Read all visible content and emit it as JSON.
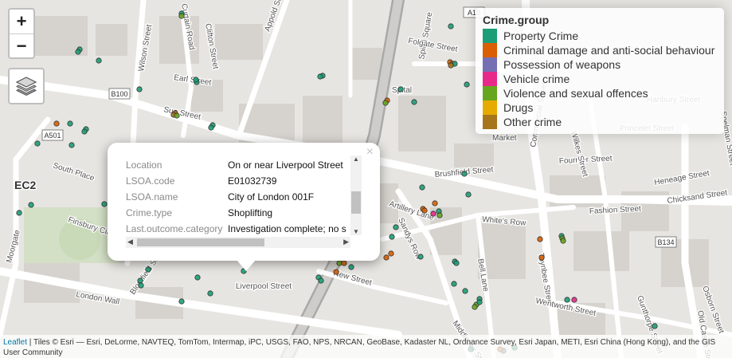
{
  "map": {
    "area_labels": [
      "EC2"
    ],
    "street_labels": [
      "Curtain Road",
      "Clifton Street",
      "Appold Street",
      "Wilson Street",
      "Earl Street",
      "Sun Street",
      "South Place",
      "Finsbury Circus",
      "Moorgate",
      "London Wall",
      "Blomfield Street",
      "Liverpool Street",
      "New Street",
      "Artillery Lane",
      "Sandys Row",
      "Bell Lane",
      "Toynbee Street",
      "Commercial Street",
      "Wentworth Street",
      "Gunthorpe Street",
      "Osborn Street",
      "Fashion Street",
      "Chicksand Street",
      "Heneage Street",
      "Fournier Street",
      "Brushfield Street",
      "White's Row",
      "Spital Square",
      "Folgate Street",
      "Spital",
      "Market",
      "Wilkes Street",
      "Princelet Street",
      "Hanbury Street",
      "Spelman Street",
      "Middlesex Street",
      "Old Castle Street"
    ],
    "road_badges": [
      "B100",
      "A501",
      "A10",
      "B134"
    ]
  },
  "controls": {
    "zoom_in": "+",
    "zoom_out": "−"
  },
  "legend": {
    "title": "Crime.group",
    "items": [
      {
        "label": "Property Crime",
        "color": "#1b9e77"
      },
      {
        "label": "Criminal damage and anti-social behaviour",
        "color": "#d95f02"
      },
      {
        "label": "Possession of weapons",
        "color": "#7570b3"
      },
      {
        "label": "Vehicle crime",
        "color": "#e7298a"
      },
      {
        "label": "Violence and sexual offences",
        "color": "#66a61e"
      },
      {
        "label": "Drugs",
        "color": "#e6ab02"
      },
      {
        "label": "Other crime",
        "color": "#a6761d"
      }
    ]
  },
  "popup": {
    "close": "×",
    "rows": [
      {
        "key": "Location",
        "value": "On or near Liverpool Street"
      },
      {
        "key": "LSOA.code",
        "value": "E01032739"
      },
      {
        "key": "LSOA.name",
        "value": "City of London 001F"
      },
      {
        "key": "Crime.type",
        "value": "Shoplifting"
      },
      {
        "key": "Last.outcome.category",
        "value": "Investigation complete; no s"
      }
    ]
  },
  "attribution": {
    "link": "Leaflet",
    "text": " | Tiles © Esri — Esri, DeLorme, NAVTEQ, TomTom, Intermap, iPC, USGS, FAO, NPS, NRCAN, GeoBase, Kadaster NL, Ordnance Survey, Esri Japan, METI, Esri China (Hong Kong), and the GIS User Community"
  }
}
